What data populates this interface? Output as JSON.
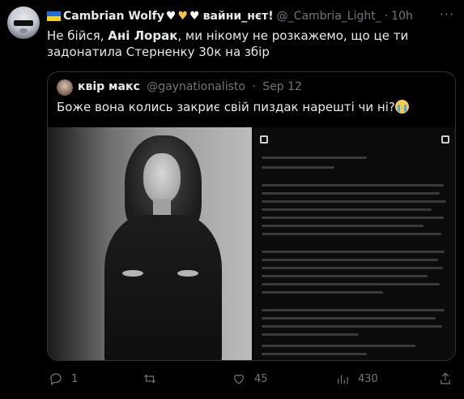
{
  "tweet": {
    "author_name": "Cambrian Wolfy",
    "author_name_suffix": "вайни_нєт!",
    "handle": "@_Cambria_Light_",
    "separator": "·",
    "time": "10h",
    "text_part1": "Не бійся, ",
    "text_bold": "Ані Лорак",
    "text_part2": ", ми нікому не розкажемо, що це ти задонатила Стерненку 30к на збір",
    "more": "···"
  },
  "quote": {
    "author_name": "квір макс",
    "handle": "@gaynationalisto",
    "separator": "·",
    "time": "Sep 12",
    "text": "Боже вона колись закриє свій пиздак нарешті чи ні?"
  },
  "actions": {
    "reply_count": "1",
    "retweet_count": "",
    "like_count": "45",
    "views_count": "430"
  },
  "colors": {
    "background": "#000000",
    "text": "#e7e9ea",
    "secondary": "#71767b",
    "border": "#2f3336"
  },
  "icons": [
    "reply-icon",
    "retweet-icon",
    "like-icon",
    "views-icon",
    "share-icon",
    "more-icon"
  ]
}
